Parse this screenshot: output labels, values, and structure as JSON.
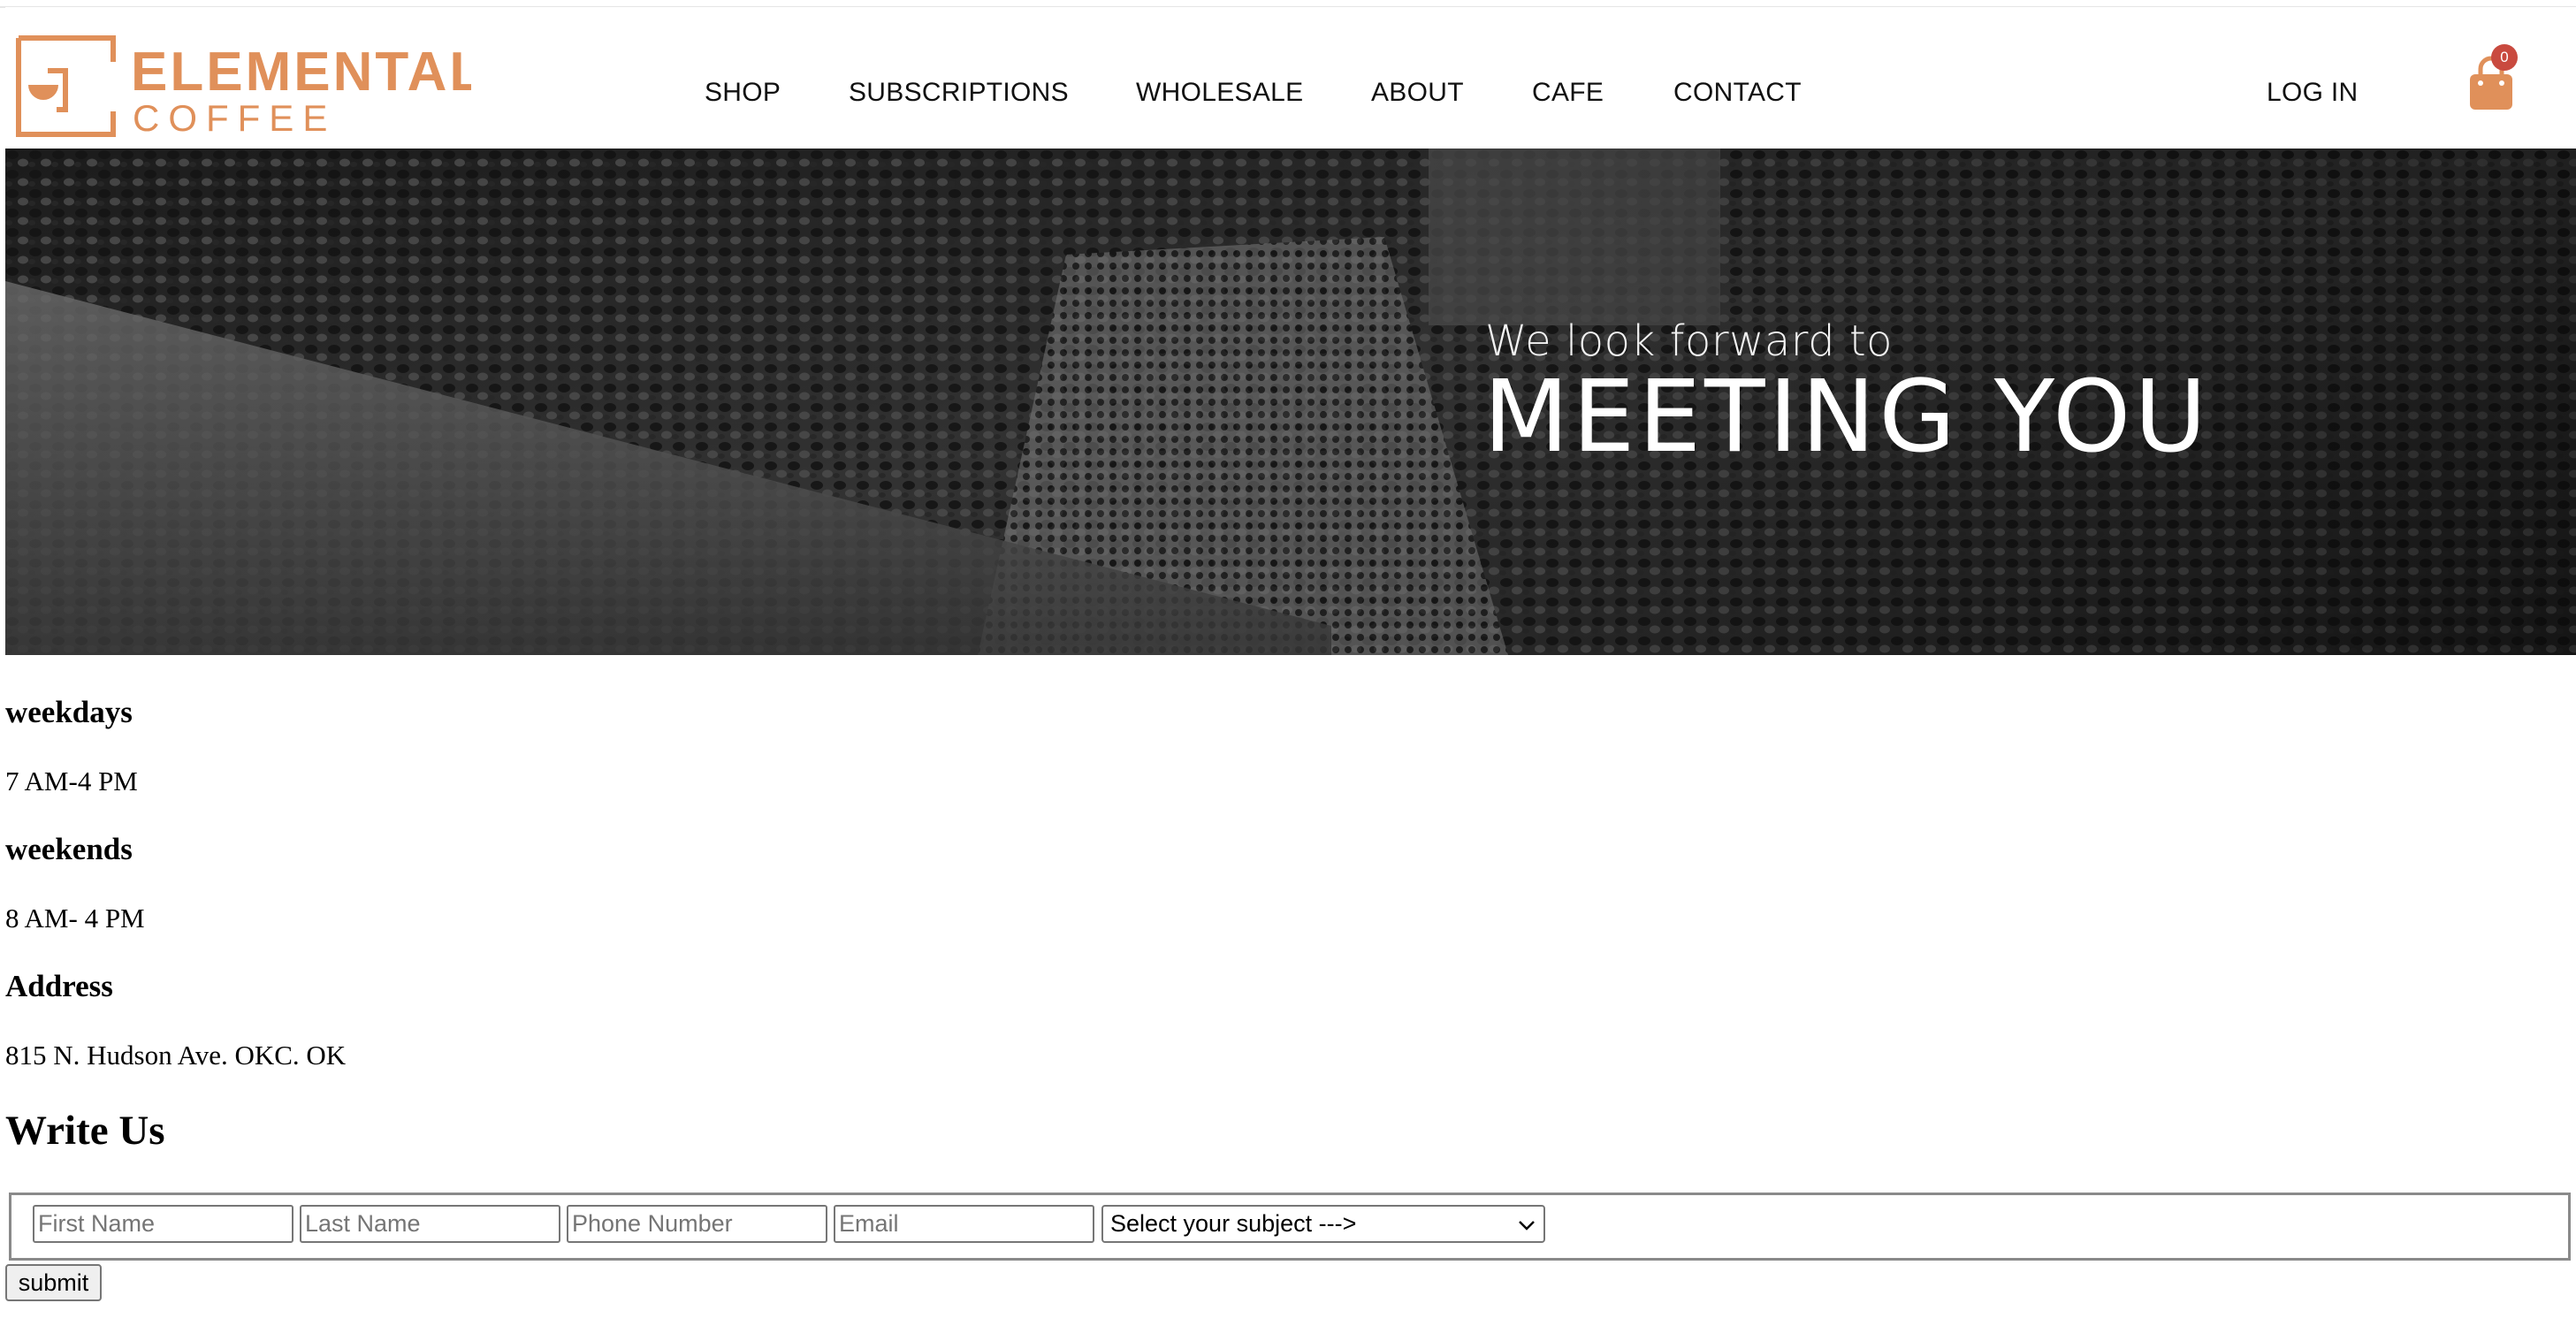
{
  "brand": {
    "name_line1": "ELEMENTAL",
    "name_line2": "COFFEE",
    "color": "#e0905a"
  },
  "nav": {
    "items": [
      {
        "label": "SHOP"
      },
      {
        "label": "SUBSCRIPTIONS"
      },
      {
        "label": "WHOLESALE"
      },
      {
        "label": "ABOUT"
      },
      {
        "label": "CAFE"
      },
      {
        "label": "CONTACT"
      }
    ],
    "login_label": "LOG IN",
    "cart_count": "0",
    "cart_icon": "shopping-bag-icon"
  },
  "hero": {
    "subtitle": "We look forward to",
    "title": "MEETING YOU"
  },
  "hours": {
    "weekdays_heading": "weekdays",
    "weekdays_hours": "7 AM-4 PM",
    "weekends_heading": "weekends",
    "weekends_hours": "8 AM- 4 PM",
    "address_heading": "Address",
    "address": "815 N. Hudson Ave. OKC. OK"
  },
  "form": {
    "heading": "Write Us",
    "first_name_placeholder": "First Name",
    "last_name_placeholder": "Last Name",
    "phone_placeholder": "Phone Number",
    "email_placeholder": "Email",
    "subject_selected": "Select your subject --->",
    "submit_label": "submit"
  },
  "colors": {
    "accent": "#e0905a",
    "badge": "#c94a3f",
    "hero_bg": "#2b2b2b"
  }
}
